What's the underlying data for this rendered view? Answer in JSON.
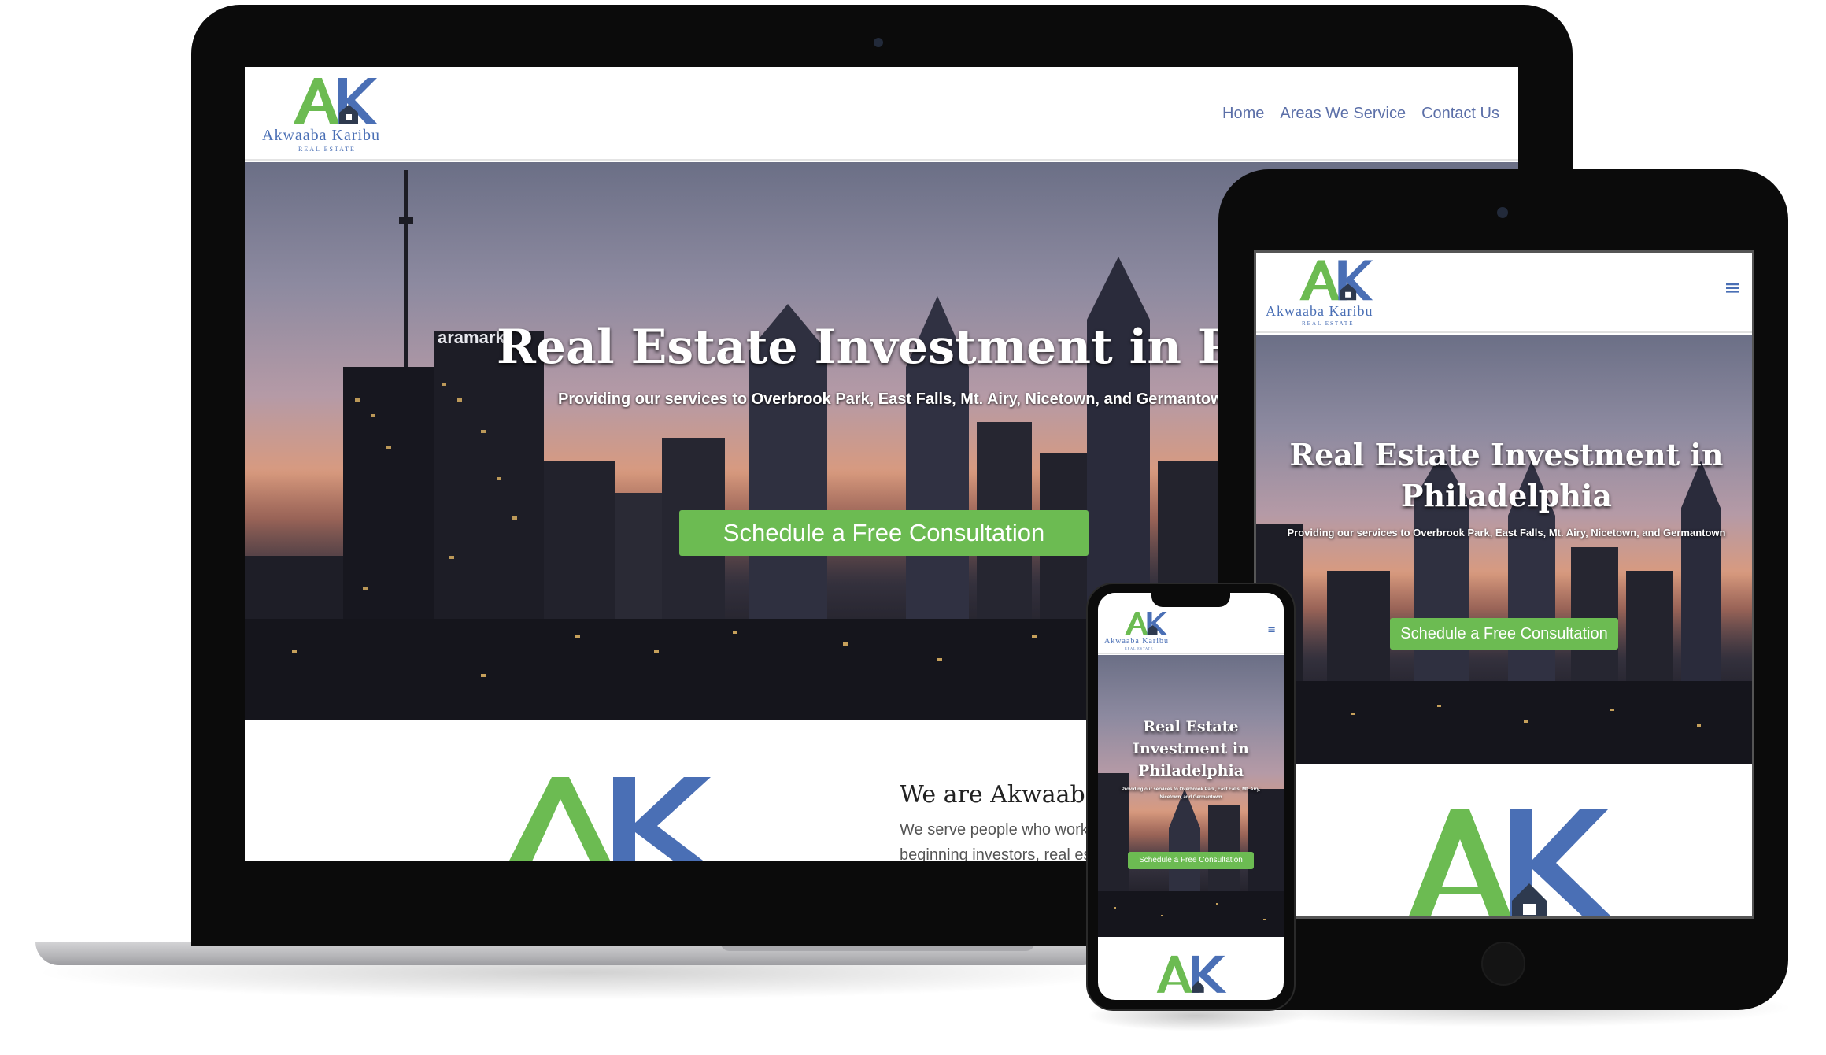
{
  "colors": {
    "brand_green": "#6cbb52",
    "brand_blue": "#4a6fb5",
    "device_black": "#0b0b0b"
  },
  "logo": {
    "letters_a": "A",
    "letters_k": "K",
    "wordmark": "Akwaaba Karibu",
    "subtitle": "REAL ESTATE"
  },
  "desktop": {
    "nav": {
      "home": "Home",
      "areas": "Areas We Service",
      "contact": "Contact Us"
    },
    "hero": {
      "title": "Real Estate Investment in Philadelphia",
      "subtitle": "Providing our services to Overbrook Park, East Falls, Mt. Airy, Nicetown, and Germantown",
      "cta": "Schedule a Free Consultation",
      "building_sign": "aramark"
    },
    "about": {
      "heading": "We are Akwaaba Karibu",
      "line1": "We serve people who work",
      "line2": "beginning investors, real estate"
    }
  },
  "tablet": {
    "menu_icon": "≡",
    "hero": {
      "title_line1": "Real Estate Investment in",
      "title_line2": "Philadelphia",
      "subtitle": "Providing our services to Overbrook Park, East Falls, Mt. Airy, Nicetown, and Germantown",
      "cta": "Schedule a Free Consultation"
    }
  },
  "phone": {
    "menu_icon": "≡",
    "hero": {
      "title_line1": "Real Estate",
      "title_line2": "Investment in",
      "title_line3": "Philadelphia",
      "subtitle_line1": "Providing our services to Overbrook Park, East Falls, Mt. Airy,",
      "subtitle_line2": "Nicetown, and Germantown",
      "cta": "Schedule a Free Consultation"
    }
  }
}
